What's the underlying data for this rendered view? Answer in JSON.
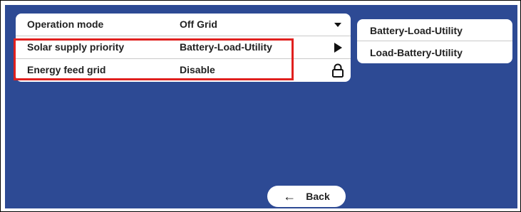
{
  "settings": {
    "rows": [
      {
        "label": "Operation mode",
        "value": "Off Grid",
        "icon": "dropdown-caret-icon"
      },
      {
        "label": "Solar supply priority",
        "value": "Battery-Load-Utility",
        "icon": "play-arrow-icon"
      },
      {
        "label": "Energy feed grid",
        "value": "Disable",
        "icon": "lock-icon"
      }
    ]
  },
  "options": [
    {
      "label": "Battery-Load-Utility"
    },
    {
      "label": "Load-Battery-Utility"
    }
  ],
  "back": {
    "arrow": "←",
    "label": "Back"
  },
  "colors": {
    "background": "#2d4a94",
    "panel": "#ffffff",
    "highlight": "#e0201e",
    "text": "#222222"
  }
}
